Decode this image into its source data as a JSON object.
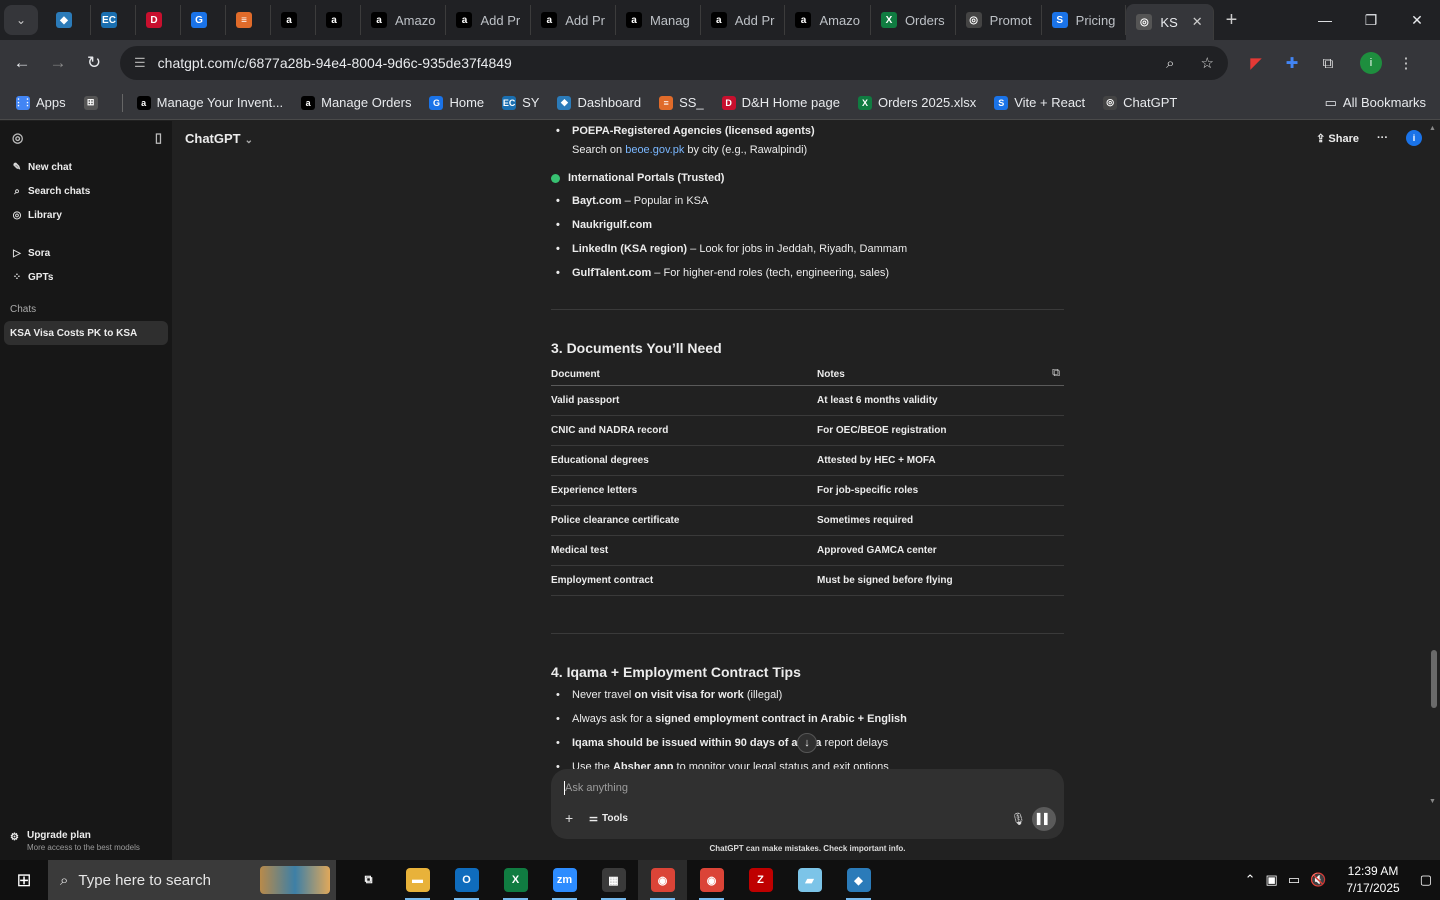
{
  "tabs": [
    {
      "label": "",
      "fav": "◆",
      "color": "#2b7bb9"
    },
    {
      "label": "",
      "fav": "EC",
      "color": "#1a6fb0"
    },
    {
      "label": "",
      "fav": "D",
      "color": "#c8102e"
    },
    {
      "label": "",
      "fav": "G",
      "color": "#1a73e8"
    },
    {
      "label": "",
      "fav": "≡",
      "color": "#e06b2a"
    },
    {
      "label": "",
      "fav": "a",
      "color": "#000000"
    },
    {
      "label": "",
      "fav": "a",
      "color": "#000000"
    },
    {
      "label": "Amazo",
      "fav": "a",
      "color": "#000000"
    },
    {
      "label": "Add Pr",
      "fav": "a",
      "color": "#000000"
    },
    {
      "label": "Add Pr",
      "fav": "a",
      "color": "#000000"
    },
    {
      "label": "Manag",
      "fav": "a",
      "color": "#000000"
    },
    {
      "label": "Add Pr",
      "fav": "a",
      "color": "#000000"
    },
    {
      "label": "Amazo",
      "fav": "a",
      "color": "#000000"
    },
    {
      "label": "Orders",
      "fav": "X",
      "color": "#107c41"
    },
    {
      "label": "Promot",
      "fav": "◎",
      "color": "#444444"
    },
    {
      "label": "Pricing",
      "fav": "S",
      "color": "#1a73e8"
    }
  ],
  "active_tab": {
    "label": "KS",
    "fav": "◎"
  },
  "url": "chatgpt.com/c/6877a28b-94e4-8004-9d6c-935de37f4849",
  "bookmarks": [
    {
      "label": "Apps",
      "icon": "apps-icon",
      "color": "#4285f4",
      "glyph": "⋮⋮"
    },
    {
      "label": "",
      "icon": "grid-icon",
      "color": "#555555",
      "glyph": "⊞"
    },
    {
      "label": "Manage Your Invent...",
      "icon": "amazon-icon",
      "color": "#000000",
      "glyph": "a"
    },
    {
      "label": "Manage Orders",
      "icon": "amazon-icon",
      "color": "#000000",
      "glyph": "a"
    },
    {
      "label": "Home",
      "icon": "home-icon",
      "color": "#1a73e8",
      "glyph": "G"
    },
    {
      "label": "SY",
      "icon": "ec-icon",
      "color": "#1a6fb0",
      "glyph": "EC"
    },
    {
      "label": "Dashboard",
      "icon": "dashboard-icon",
      "color": "#2b7bb9",
      "glyph": "◆"
    },
    {
      "label": "SS_",
      "icon": "ss-icon",
      "color": "#e06b2a",
      "glyph": "≡"
    },
    {
      "label": "D&H Home page",
      "icon": "dh-icon",
      "color": "#c8102e",
      "glyph": "D"
    },
    {
      "label": "Orders 2025.xlsx",
      "icon": "excel-icon",
      "color": "#107c41",
      "glyph": "X"
    },
    {
      "label": "Vite + React",
      "icon": "vite-icon",
      "color": "#1a73e8",
      "glyph": "S"
    },
    {
      "label": "ChatGPT",
      "icon": "chatgpt-icon",
      "color": "#444444",
      "glyph": "◎"
    }
  ],
  "all_bookmarks": "All Bookmarks",
  "sidebar": {
    "items": [
      {
        "label": "New chat",
        "icon": "✎"
      },
      {
        "label": "Search chats",
        "icon": "⌕"
      },
      {
        "label": "Library",
        "icon": "◎"
      }
    ],
    "items2": [
      {
        "label": "Sora",
        "icon": "▷"
      },
      {
        "label": "GPTs",
        "icon": "⁘"
      }
    ],
    "chats_label": "Chats",
    "active_chat": "KSA Visa Costs PK to KSA",
    "upgrade_title": "Upgrade plan",
    "upgrade_sub": "More access to the best models"
  },
  "topbar": {
    "model": "ChatGPT",
    "share": "Share",
    "avatar": "i"
  },
  "content": {
    "poepa_title": "POEPA-Registered Agencies (licensed agents)",
    "poepa_prefix": "Search on ",
    "poepa_link": "beoe.gov.pk",
    "poepa_suffix": " by city (e.g., Rawalpindi)",
    "intl_heading": "International Portals (Trusted)",
    "portals": [
      {
        "b": "Bayt.com",
        "n": " – Popular in KSA"
      },
      {
        "b": "Naukrigulf.com",
        "n": ""
      },
      {
        "b": "LinkedIn (KSA region)",
        "n": " – Look for jobs in Jeddah, Riyadh, Dammam"
      },
      {
        "b": "GulfTalent.com",
        "n": " – For higher-end roles (tech, engineering, sales)"
      }
    ],
    "docs_heading": "3. Documents You’ll Need",
    "table_headers": [
      "Document",
      "Notes"
    ],
    "table_rows": [
      [
        "Valid passport",
        "At least 6 months validity"
      ],
      [
        "CNIC and NADRA record",
        "For OEC/BEOE registration"
      ],
      [
        "Educational degrees",
        "Attested by HEC + MOFA"
      ],
      [
        "Experience letters",
        "For job-specific roles"
      ],
      [
        "Police clearance certificate",
        "Sometimes required"
      ],
      [
        "Medical test",
        "Approved GAMCA center"
      ],
      [
        "Employment contract",
        "Must be signed before flying"
      ]
    ],
    "iqama_heading": "4. Iqama + Employment Contract Tips",
    "tips": [
      {
        "n1": "Never travel ",
        "b": "on visit visa for work",
        "n2": " (illegal)"
      },
      {
        "n1": "Always ask for a ",
        "b": "signed employment contract in Arabic + English",
        "n2": ""
      },
      {
        "n1": "",
        "b": "Iqama should be issued within 90 days of arriva",
        "n2": " report delays"
      },
      {
        "n1": "Use the ",
        "b": "Absher app",
        "n2": " to monitor your legal status and exit options"
      }
    ]
  },
  "composer": {
    "placeholder": "Ask anything",
    "tools": "Tools"
  },
  "disclaimer": "ChatGPT can make mistakes. Check important info.",
  "scroll_position": 0.86,
  "taskbar": {
    "search_placeholder": "Type here to search",
    "apps": [
      {
        "name": "task-view-icon",
        "glyph": "⧉",
        "color": "transparent"
      },
      {
        "name": "file-explorer-icon",
        "glyph": "▬",
        "color": "#e8b23a"
      },
      {
        "name": "outlook-icon",
        "glyph": "O",
        "color": "#0f6cbd"
      },
      {
        "name": "excel-icon",
        "glyph": "X",
        "color": "#107c41"
      },
      {
        "name": "zoom-icon",
        "glyph": "zm",
        "color": "#2d8cff"
      },
      {
        "name": "calculator-icon",
        "glyph": "▦",
        "color": "#3a3a3a"
      },
      {
        "name": "chrome-icon",
        "glyph": "◉",
        "color": "#db4437"
      },
      {
        "name": "chrome-icon",
        "glyph": "◉",
        "color": "#db4437"
      },
      {
        "name": "filezilla-icon",
        "glyph": "Z",
        "color": "#bf0000"
      },
      {
        "name": "notepad-icon",
        "glyph": "▰",
        "color": "#7cc4e8"
      },
      {
        "name": "app-icon",
        "glyph": "◆",
        "color": "#2b7bb9"
      }
    ],
    "time": "12:39 AM",
    "date": "7/17/2025"
  }
}
